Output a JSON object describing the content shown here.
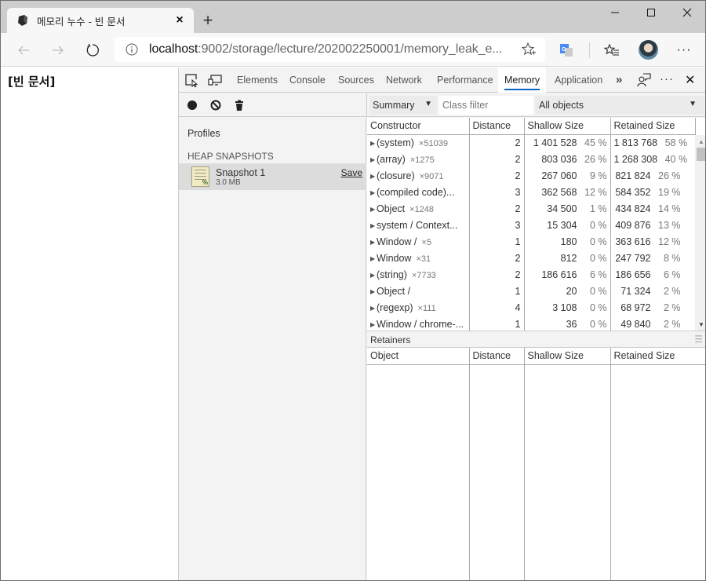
{
  "browser": {
    "tab": {
      "title": "메모리 누수 - 빈 문서",
      "favicon": "shield-favicon-icon",
      "close_icon": "×"
    },
    "new_tab_icon": "+",
    "window_controls": {
      "minimize": "minimize-icon",
      "maximize": "maximize-icon",
      "close": "close-icon"
    },
    "address": {
      "host": "localhost",
      "rest": ":9002/storage/lecture/202002250001/memory_leak_e..."
    },
    "toolbar_icons": [
      "back-icon",
      "forward-icon",
      "reload-icon",
      "info-icon",
      "favorite-star-icon",
      "translate-icon",
      "favorites-icon",
      "avatar",
      "more-icon"
    ],
    "more_label": "···"
  },
  "page": {
    "heading": "[빈 문서]"
  },
  "devtools": {
    "tabs": [
      {
        "label": "Elements",
        "active": false
      },
      {
        "label": "Console",
        "active": false
      },
      {
        "label": "Sources",
        "active": false
      },
      {
        "label": "Network",
        "active": false
      },
      {
        "label": "Performance",
        "active": false
      },
      {
        "label": "Memory",
        "active": true
      },
      {
        "label": "Application",
        "active": false
      }
    ],
    "more_tabs_label": "»",
    "menu_label": "···",
    "close_label": "✕",
    "memory_toolbar": {
      "view_select": "Summary",
      "class_filter_placeholder": "Class filter",
      "objects_select": "All objects"
    },
    "profiles": {
      "title": "Profiles",
      "section": "HEAP SNAPSHOTS",
      "snapshots": [
        {
          "name": "Snapshot 1",
          "size": "3.0 MB",
          "save_label": "Save"
        }
      ]
    },
    "summary": {
      "columns": [
        "Constructor",
        "Distance",
        "Shallow Size",
        "Retained Size"
      ],
      "rows": [
        {
          "name": "(system)",
          "count": "×51039",
          "distance": "2",
          "shallow": "1 401 528",
          "shallow_pct": "45 %",
          "retained": "1 813 768",
          "retained_pct": "58 %"
        },
        {
          "name": "(array)",
          "count": "×1275",
          "distance": "2",
          "shallow": "803 036",
          "shallow_pct": "26 %",
          "retained": "1 268 308",
          "retained_pct": "40 %"
        },
        {
          "name": "(closure)",
          "count": "×9071",
          "distance": "2",
          "shallow": "267 060",
          "shallow_pct": "9 %",
          "retained": "821 824",
          "retained_pct": "26 %"
        },
        {
          "name": "(compiled code)...",
          "count": "",
          "distance": "3",
          "shallow": "362 568",
          "shallow_pct": "12 %",
          "retained": "584 352",
          "retained_pct": "19 %"
        },
        {
          "name": "Object",
          "count": "×1248",
          "distance": "2",
          "shallow": "34 500",
          "shallow_pct": "1 %",
          "retained": "434 824",
          "retained_pct": "14 %"
        },
        {
          "name": "system / Context...",
          "count": "",
          "distance": "3",
          "shallow": "15 304",
          "shallow_pct": "0 %",
          "retained": "409 876",
          "retained_pct": "13 %"
        },
        {
          "name": "Window /",
          "count": "×5",
          "distance": "1",
          "shallow": "180",
          "shallow_pct": "0 %",
          "retained": "363 616",
          "retained_pct": "12 %"
        },
        {
          "name": "Window",
          "count": "×31",
          "distance": "2",
          "shallow": "812",
          "shallow_pct": "0 %",
          "retained": "247 792",
          "retained_pct": "8 %"
        },
        {
          "name": "(string)",
          "count": "×7733",
          "distance": "2",
          "shallow": "186 616",
          "shallow_pct": "6 %",
          "retained": "186 656",
          "retained_pct": "6 %"
        },
        {
          "name": "Object /",
          "count": "",
          "distance": "1",
          "shallow": "20",
          "shallow_pct": "0 %",
          "retained": "71 324",
          "retained_pct": "2 %"
        },
        {
          "name": "(regexp)",
          "count": "×111",
          "distance": "4",
          "shallow": "3 108",
          "shallow_pct": "0 %",
          "retained": "68 972",
          "retained_pct": "2 %"
        },
        {
          "name": "Window / chrome-...",
          "count": "",
          "distance": "1",
          "shallow": "36",
          "shallow_pct": "0 %",
          "retained": "49 840",
          "retained_pct": "2 %"
        }
      ]
    },
    "retainers": {
      "title": "Retainers",
      "columns": [
        "Object",
        "Distance",
        "Shallow Size",
        "Retained Size"
      ]
    }
  }
}
